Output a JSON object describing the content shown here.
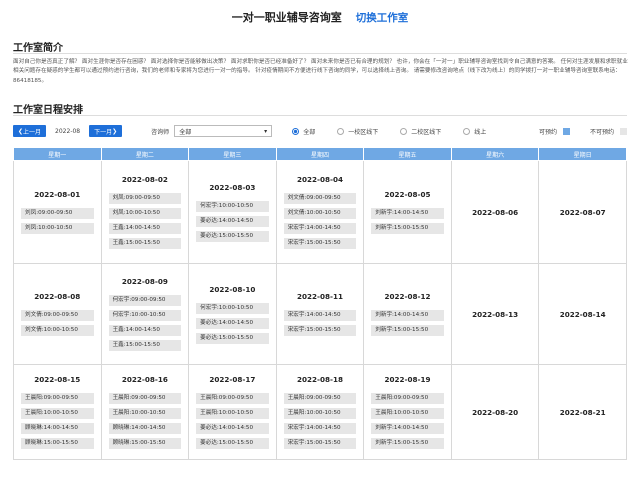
{
  "header": {
    "title": "一对一职业辅导咨询室",
    "switch_label": "切换工作室"
  },
  "intro": {
    "title": "工作室简介",
    "text": "面对自己你是否真正了解？ 面对生涯你是否存在困惑？ 面对选择你是否能够做出决策？ 面对求职你是否已经准备好了？ 面对未来你是否已有合理的规划？ 也许，你会在「一对一」职业辅导咨询室找到令自己满意的答案。 任何对生涯发展和求职就业相关问题存在疑惑的学生都可以通过预约进行咨询，我们的老师和专家将为您进行一对一的指导。 针对疫情期间不方便进行线下咨询的同学，可以选择线上咨询。 请需要修改咨询地点（线下改为线上）的同学拨打一对一职业辅导咨询室联系电话：86418185。"
  },
  "schedule": {
    "title": "工作室日程安排",
    "prev_label": "上一月",
    "current_month": "2022-08",
    "next_label": "下一月",
    "counselor_label": "咨询师",
    "counselor_value": "全部",
    "locations": [
      "全部",
      "一校区线下",
      "二校区线下",
      "线上"
    ],
    "legend_available": "可预约",
    "legend_unavailable": "不可预约",
    "available_color": "#6fa8e4",
    "unavailable_color": "#e6e6e6",
    "weekdays": [
      "星期一",
      "星期二",
      "星期三",
      "星期四",
      "星期五",
      "星期六",
      "星期日"
    ],
    "weeks": [
      [
        {
          "date": "2022-08-01",
          "slots": [
            "刘凤:09:00-09:50",
            "刘凤:10:00-10:50"
          ]
        },
        {
          "date": "2022-08-02",
          "slots": [
            "刘凤:09:00-09:50",
            "刘凤:10:00-10:50",
            "王鑫:14:00-14:50",
            "王鑫:15:00-15:50"
          ]
        },
        {
          "date": "2022-08-03",
          "slots": [
            "何宏宇:10:00-10:50",
            "姜必达:14:00-14:50",
            "姜必达:15:00-15:50"
          ]
        },
        {
          "date": "2022-08-04",
          "slots": [
            "刘文倩:09:00-09:50",
            "刘文倩:10:00-10:50",
            "宋宏宇:14:00-14:50",
            "宋宏宇:15:00-15:50"
          ]
        },
        {
          "date": "2022-08-05",
          "slots": [
            "刘新宇:14:00-14:50",
            "刘新宇:15:00-15:50"
          ]
        },
        {
          "date": "2022-08-06",
          "slots": []
        },
        {
          "date": "2022-08-07",
          "slots": []
        }
      ],
      [
        {
          "date": "2022-08-08",
          "slots": [
            "刘文倩:09:00-09:50",
            "刘文倩:10:00-10:50"
          ]
        },
        {
          "date": "2022-08-09",
          "slots": [
            "何宏宇:09:00-09:50",
            "何宏宇:10:00-10:50",
            "王鑫:14:00-14:50",
            "王鑫:15:00-15:50"
          ]
        },
        {
          "date": "2022-08-10",
          "slots": [
            "何宏宇:10:00-10:50",
            "姜必达:14:00-14:50",
            "姜必达:15:00-15:50"
          ]
        },
        {
          "date": "2022-08-11",
          "slots": [
            "宋宏宇:14:00-14:50",
            "宋宏宇:15:00-15:50"
          ]
        },
        {
          "date": "2022-08-12",
          "slots": [
            "刘新宇:14:00-14:50",
            "刘新宇:15:00-15:50"
          ]
        },
        {
          "date": "2022-08-13",
          "slots": []
        },
        {
          "date": "2022-08-14",
          "slots": []
        }
      ],
      [
        {
          "date": "2022-08-15",
          "slots": [
            "王晨阳:09:00-09:50",
            "王晨阳:10:00-10:50",
            "顾晓琳:14:00-14:50",
            "顾晓琳:15:00-15:50"
          ]
        },
        {
          "date": "2022-08-16",
          "slots": [
            "王晨阳:09:00-09:50",
            "王晨阳:10:00-10:50",
            "顾晓琳:14:00-14:50",
            "顾晓琳:15:00-15:50"
          ]
        },
        {
          "date": "2022-08-17",
          "slots": [
            "王晨阳:09:00-09:50",
            "王晨阳:10:00-10:50",
            "姜必达:14:00-14:50",
            "姜必达:15:00-15:50"
          ]
        },
        {
          "date": "2022-08-18",
          "slots": [
            "王晨阳:09:00-09:50",
            "王晨阳:10:00-10:50",
            "宋宏宇:14:00-14:50",
            "宋宏宇:15:00-15:50"
          ]
        },
        {
          "date": "2022-08-19",
          "slots": [
            "王晨阳:09:00-09:50",
            "王晨阳:10:00-10:50",
            "刘新宇:14:00-14:50",
            "刘新宇:15:00-15:50"
          ]
        },
        {
          "date": "2022-08-20",
          "slots": []
        },
        {
          "date": "2022-08-21",
          "slots": []
        }
      ]
    ]
  }
}
